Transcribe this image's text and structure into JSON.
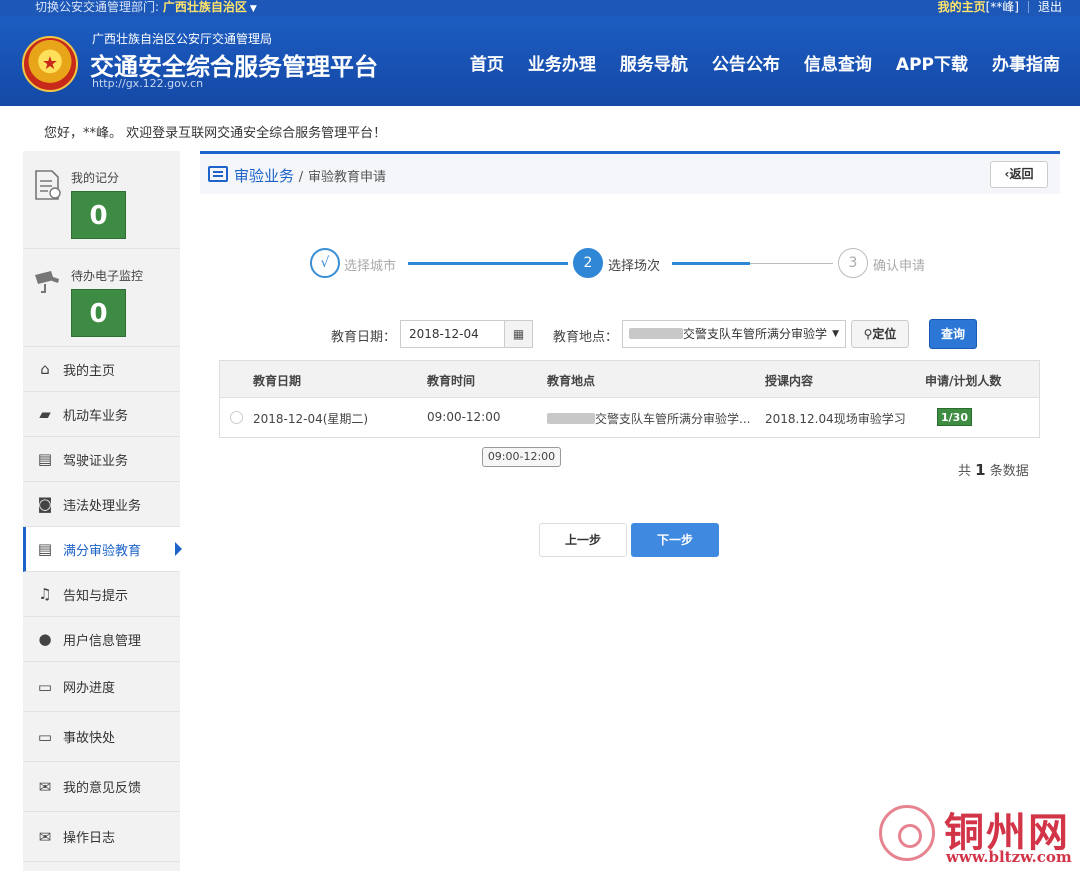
{
  "topbar": {
    "switch_label": "切换公安交通管理部门:",
    "region": "广西壮族自治区",
    "my_home": "我的主页",
    "user": "[**峰]",
    "logout": "退出"
  },
  "header": {
    "org": "广西壮族自治区公安厅交通管理局",
    "title": "交通安全综合服务管理平台",
    "url": "http://gx.122.gov.cn",
    "nav": [
      "首页",
      "业务办理",
      "服务导航",
      "公告公布",
      "信息查询",
      "APP下载",
      "办事指南"
    ]
  },
  "welcome": "您好，**峰。 欢迎登录互联网交通安全综合服务管理平台！",
  "sidebar": {
    "score_label": "我的记分",
    "score_value": "0",
    "monitor_label": "待办电子监控",
    "monitor_value": "0",
    "items": [
      {
        "label": "我的主页",
        "icon": "home-icon"
      },
      {
        "label": "机动车业务",
        "icon": "truck-icon"
      },
      {
        "label": "驾驶证业务",
        "icon": "card-icon"
      },
      {
        "label": "违法处理业务",
        "icon": "camera-icon"
      },
      {
        "label": "满分审验教育",
        "icon": "list-icon"
      },
      {
        "label": "告知与提示",
        "icon": "bell-icon"
      },
      {
        "label": "用户信息管理",
        "icon": "user-icon"
      },
      {
        "label": "网办进度",
        "icon": "progress-icon"
      },
      {
        "label": "事故快处",
        "icon": "accident-icon"
      },
      {
        "label": "我的意见反馈",
        "icon": "feedback-icon"
      },
      {
        "label": "操作日志",
        "icon": "log-icon"
      }
    ]
  },
  "breadcrumb": {
    "section": "审验业务",
    "separator": "/",
    "page": "审验教育申请",
    "back": "返回"
  },
  "steps": [
    {
      "num": "√",
      "label": "选择城市"
    },
    {
      "num": "2",
      "label": "选择场次"
    },
    {
      "num": "3",
      "label": "确认申请"
    }
  ],
  "filter": {
    "date_label": "教育日期：",
    "date_value": "2018-12-04",
    "location_label": "教育地点：",
    "location_value": "交警支队车管所满分审验学",
    "locate_button": "定位",
    "query_button": "查询"
  },
  "table": {
    "headers": [
      "教育日期",
      "教育时间",
      "教育地点",
      "授课内容",
      "申请/计划人数"
    ],
    "rows": [
      {
        "date": "2018-12-04(星期二)",
        "time": "09:00-12:00",
        "location": "交警支队车管所满分审验学...",
        "content": "2018.12.04现场审验学习",
        "count": "1/30"
      }
    ],
    "tooltip": "09:00-12:00"
  },
  "total": {
    "prefix": "共",
    "count": "1",
    "suffix": "条数据"
  },
  "buttons": {
    "prev": "上一步",
    "next": "下一步"
  },
  "watermark": {
    "name": "铜州网",
    "url": "www.bltzw.com"
  },
  "colors": {
    "primary": "#1d63c9",
    "header": "#1549a6",
    "green": "#3e8c43"
  }
}
